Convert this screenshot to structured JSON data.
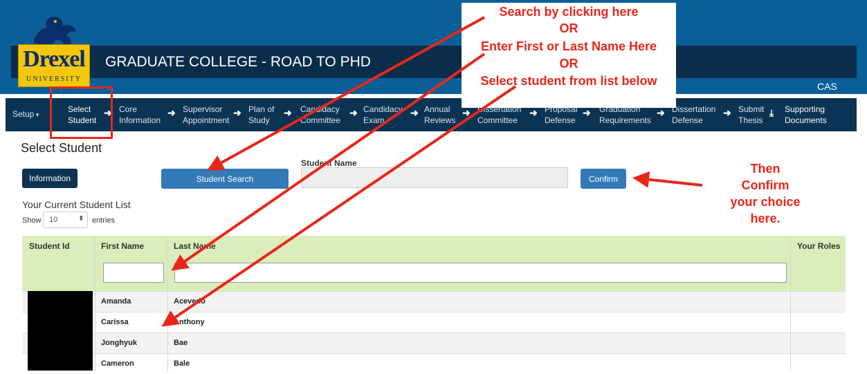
{
  "app": {
    "logo_text": "Drexel",
    "logo_subtext": "UNIVERSITY",
    "title": "GRADUATE COLLEGE - ROAD TO PHD",
    "logout": "CAS Logout"
  },
  "nav": {
    "setup": "Setup",
    "items": [
      {
        "l1": "Select",
        "l2": "Student"
      },
      {
        "l1": "Core",
        "l2": "Information"
      },
      {
        "l1": "Supervisor",
        "l2": "Appointment"
      },
      {
        "l1": "Plan of",
        "l2": "Study"
      },
      {
        "l1": "Candidacy",
        "l2": "Committee"
      },
      {
        "l1": "Candidacy",
        "l2": "Exam"
      },
      {
        "l1": "Annual",
        "l2": "Reviews"
      },
      {
        "l1": "Dissertation",
        "l2": "Committee"
      },
      {
        "l1": "Proposal",
        "l2": "Defense"
      },
      {
        "l1": "Graduation",
        "l2": "Requirements"
      },
      {
        "l1": "Dissertation",
        "l2": "Defense"
      },
      {
        "l1": "Submit",
        "l2": "Thesis"
      },
      {
        "l1": "Supporting",
        "l2": "Documents"
      }
    ]
  },
  "page": {
    "title": "Select Student",
    "info_button": "Information",
    "search_button": "Student Search",
    "name_label": "Student Name",
    "confirm_button": "Confirm",
    "list_title": "Your Current Student List",
    "show_label": "Show",
    "show_value": "10",
    "entries_label": "entries"
  },
  "table": {
    "columns": [
      "Student Id",
      "First Name",
      "Last Name",
      "Your Roles"
    ],
    "rows": [
      {
        "first": "Amanda",
        "last": "Acevedo"
      },
      {
        "first": "Carissa",
        "last": "Anthony"
      },
      {
        "first": "Jonghyuk",
        "last": "Bae"
      },
      {
        "first": "Cameron",
        "last": "Bale"
      }
    ]
  },
  "annotations": {
    "callout": [
      "Search by clicking here",
      "OR",
      "Enter First or Last Name Here",
      "OR",
      "Select student from list below"
    ],
    "confirm_note": [
      "Then",
      "Confirm",
      "your choice",
      "here."
    ],
    "color": "#e8261a"
  },
  "colors": {
    "header": "#0a5f99",
    "titlebar": "#0b2d4c",
    "nav": "#0b3353",
    "primary_button": "#337ab7",
    "table_header": "#dbedbb",
    "logo_gold": "#f3c70a"
  }
}
